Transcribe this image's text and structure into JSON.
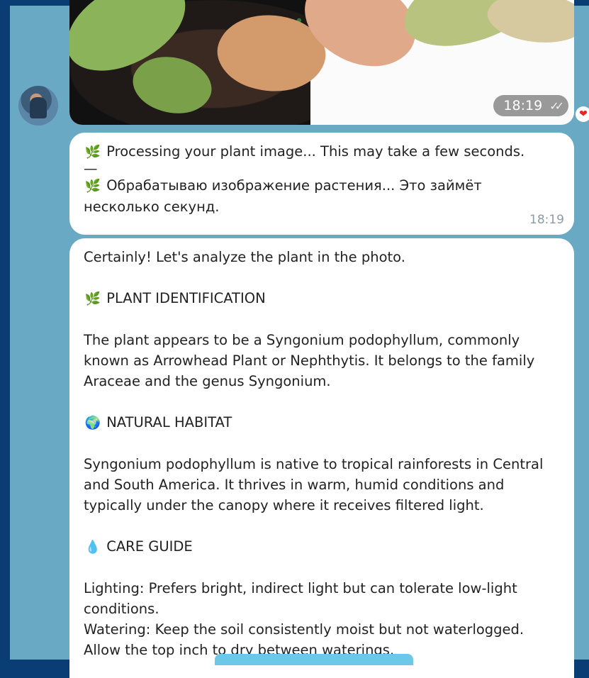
{
  "photo_message": {
    "time": "18:19",
    "reaction": "heart"
  },
  "processing_message": {
    "line_en": "Processing your plant image... This may take a few seconds.",
    "separator": "—",
    "line_ru_1": "Обрабатываю изображение растения... Это займёт",
    "line_ru_2": "несколько секунд.",
    "time": "18:19",
    "icon": "herb-icon"
  },
  "analysis_message": {
    "intro": "Certainly! Let's analyze the plant in the photo.",
    "section1_title": "PLANT IDENTIFICATION",
    "section1_icon": "herb-icon",
    "section1_text": "The plant appears to be a Syngonium podophyllum, commonly known as Arrowhead Plant or Nephthytis. It belongs to the family Araceae and the genus Syngonium.",
    "section2_title": "NATURAL HABITAT",
    "section2_icon": "globe-icon",
    "section2_text": "Syngonium podophyllum is native to tropical rainforests in Central and South America. It thrives in warm, humid conditions and typically under the canopy where it receives filtered light.",
    "section3_title": "CARE GUIDE",
    "section3_icon": "droplet-icon",
    "care_lighting": "Lighting: Prefers bright, indirect light but can tolerate low-light conditions.",
    "care_watering": "Watering: Keep the soil consistently moist but not waterlogged. Allow the top inch to dry between waterings."
  }
}
